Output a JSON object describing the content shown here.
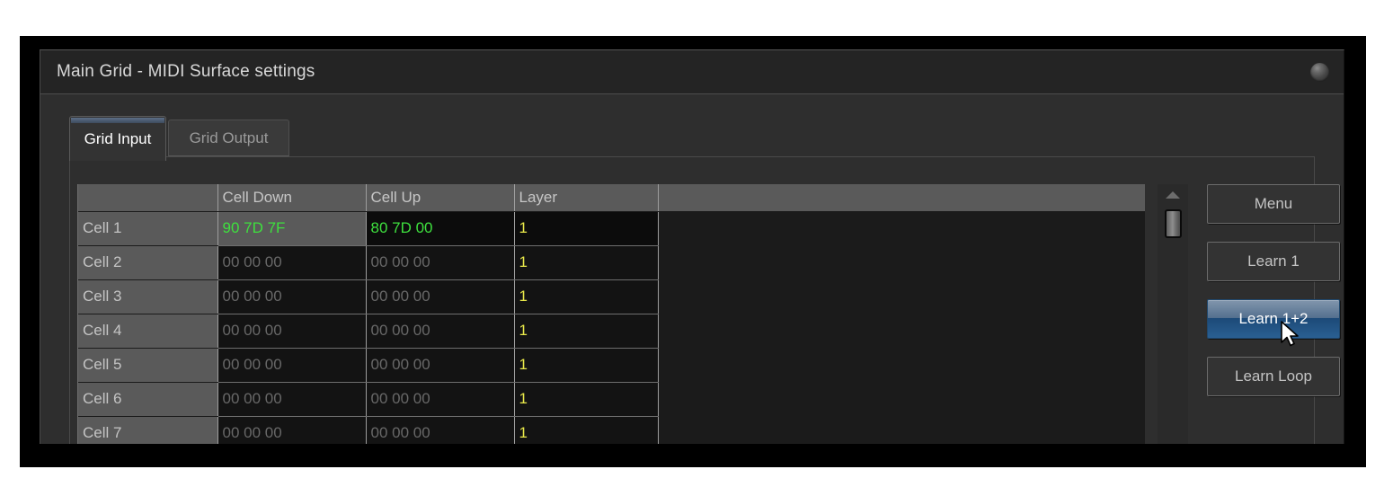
{
  "window": {
    "title": "Main Grid - MIDI Surface settings",
    "orb_icon": "sphere-button-icon"
  },
  "tabs": [
    {
      "label": "Grid Input",
      "active": true
    },
    {
      "label": "Grid Output",
      "active": false
    }
  ],
  "grid": {
    "headers": [
      "",
      "Cell Down",
      "Cell Up",
      "Layer",
      ""
    ],
    "rows": [
      {
        "label": "Cell 1",
        "down": "90 7D 7F",
        "up": "80 7D 00",
        "layer": "1",
        "active": true,
        "selected": true
      },
      {
        "label": "Cell 2",
        "down": "00 00 00",
        "up": "00 00 00",
        "layer": "1",
        "active": false,
        "selected": false
      },
      {
        "label": "Cell 3",
        "down": "00 00 00",
        "up": "00 00 00",
        "layer": "1",
        "active": false,
        "selected": false
      },
      {
        "label": "Cell 4",
        "down": "00 00 00",
        "up": "00 00 00",
        "layer": "1",
        "active": false,
        "selected": false
      },
      {
        "label": "Cell 5",
        "down": "00 00 00",
        "up": "00 00 00",
        "layer": "1",
        "active": false,
        "selected": false
      },
      {
        "label": "Cell 6",
        "down": "00 00 00",
        "up": "00 00 00",
        "layer": "1",
        "active": false,
        "selected": false
      },
      {
        "label": "Cell 7",
        "down": "00 00 00",
        "up": "00 00 00",
        "layer": "1",
        "active": false,
        "selected": false
      }
    ]
  },
  "scrollbar": {
    "up_arrow_icon": "scroll-up-arrow-icon",
    "thumb_icon": "scrollbar-thumb"
  },
  "buttons": [
    {
      "label": "Menu",
      "highlight": false
    },
    {
      "label": "Learn 1",
      "highlight": false
    },
    {
      "label": "Learn 1+2",
      "highlight": true
    },
    {
      "label": "Learn Loop",
      "highlight": false
    }
  ],
  "cursor": {
    "icon": "mouse-pointer-icon"
  },
  "colors": {
    "panel_bg": "#2e2e2e",
    "titlebar_bg": "#242424",
    "grid_bg": "#1b1b1b",
    "header_bg": "#5a5a5a",
    "active_value_text": "#3ee03e",
    "layer_text": "#e8e84a",
    "highlight_blue": "#1c4a78"
  }
}
